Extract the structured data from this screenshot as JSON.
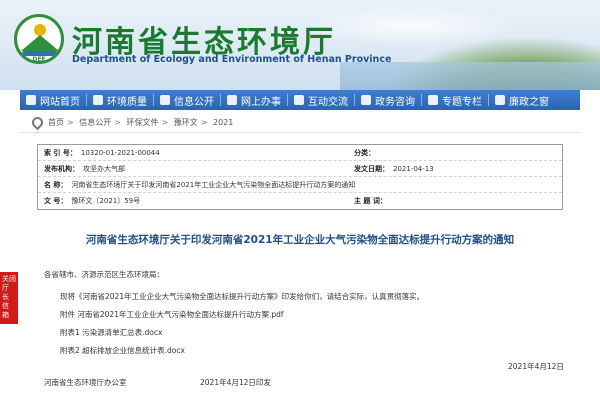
{
  "header": {
    "logo_text": "DEE",
    "title": "河南省生态环境厅",
    "subtitle": "Department of Ecology and Environment of Henan Province"
  },
  "nav": {
    "items": [
      {
        "label": "网站首页",
        "icon": "home-icon"
      },
      {
        "label": "环境质量",
        "icon": "leaf-icon"
      },
      {
        "label": "信息公开",
        "icon": "document-icon"
      },
      {
        "label": "网上办事",
        "icon": "computer-icon"
      },
      {
        "label": "互动交流",
        "icon": "chat-icon"
      },
      {
        "label": "政务咨询",
        "icon": "consult-icon"
      },
      {
        "label": "专题专栏",
        "icon": "topic-icon"
      },
      {
        "label": "廉政之窗",
        "icon": "shield-icon"
      }
    ]
  },
  "breadcrumb": {
    "items": [
      "首页",
      "信息公开",
      "环保文件",
      "豫环文",
      "2021"
    ]
  },
  "meta": {
    "index_label": "索 引 号：",
    "index_value": "10320-01-2021-00044",
    "category_label": "分类：",
    "category_value": "",
    "org_label": "发布机构：",
    "org_value": "攻坚办大气部",
    "date_label": "发文日期：",
    "date_value": "2021-04-13",
    "name_label": "名    称：",
    "name_value": "河南省生态环境厅关于印发河南省2021年工业企业大气污染物全面达标提升行动方案的通知",
    "docno_label": "文    号：",
    "docno_value": "豫环文〔2021〕59号",
    "keyword_label": "主 题 词：",
    "keyword_value": ""
  },
  "document": {
    "title": "河南省生态环境厅关于印发河南省2021年工业企业大气污染物全面达标提升行动方案的通知",
    "salutation": "各省辖市、济源示范区生态环境局：",
    "para1": "现将《河南省2021年工业企业大气污染物全面达标提升行动方案》印发给你们，请结合实际，认真贯彻落实。",
    "para2": "附件  河南省2021年工业企业大气污染物全面达标提升行动方案.pdf",
    "para3": "附表1 污染源清单汇总表.docx",
    "para4": "附表2 超标排放企业信息统计表.docx",
    "date1": "2021年4月12日",
    "issuer": "河南省生态环境厅办公室",
    "date2": "2021年4月12日印发"
  },
  "side_float": {
    "label": "关闭 厅 长 信 箱"
  }
}
